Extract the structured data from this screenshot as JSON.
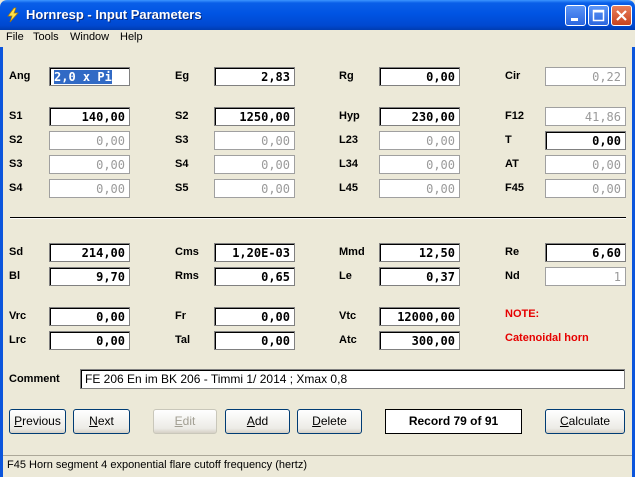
{
  "window": {
    "title": "Hornresp - Input Parameters"
  },
  "menu": [
    "File",
    "Tools",
    "Window",
    "Help"
  ],
  "params": [
    {
      "id": "ang",
      "label": "Ang",
      "value": "2,0 x Pi",
      "state": "selected"
    },
    {
      "id": "eg",
      "label": "Eg",
      "value": "2,83",
      "state": "on"
    },
    {
      "id": "rg",
      "label": "Rg",
      "value": "0,00",
      "state": "on"
    },
    {
      "id": "cir",
      "label": "Cir",
      "value": "0,22",
      "state": "off"
    },
    {
      "id": "s1",
      "label": "S1",
      "value": "140,00",
      "state": "on"
    },
    {
      "id": "s2b",
      "label": "S2",
      "value": "1250,00",
      "state": "on"
    },
    {
      "id": "hyp",
      "label": "Hyp",
      "value": "230,00",
      "state": "on"
    },
    {
      "id": "f12",
      "label": "F12",
      "value": "41,86",
      "state": "off"
    },
    {
      "id": "s2",
      "label": "S2",
      "value": "0,00",
      "state": "off"
    },
    {
      "id": "s3b",
      "label": "S3",
      "value": "0,00",
      "state": "off"
    },
    {
      "id": "l23",
      "label": "L23",
      "value": "0,00",
      "state": "off"
    },
    {
      "id": "t",
      "label": "T",
      "value": "0,00",
      "state": "on"
    },
    {
      "id": "s3",
      "label": "S3",
      "value": "0,00",
      "state": "off"
    },
    {
      "id": "s4b",
      "label": "S4",
      "value": "0,00",
      "state": "off"
    },
    {
      "id": "l34",
      "label": "L34",
      "value": "0,00",
      "state": "off"
    },
    {
      "id": "at",
      "label": "AT",
      "value": "0,00",
      "state": "off"
    },
    {
      "id": "s4",
      "label": "S4",
      "value": "0,00",
      "state": "off"
    },
    {
      "id": "s5",
      "label": "S5",
      "value": "0,00",
      "state": "off"
    },
    {
      "id": "l45",
      "label": "L45",
      "value": "0,00",
      "state": "off"
    },
    {
      "id": "f45",
      "label": "F45",
      "value": "0,00",
      "state": "off"
    },
    {
      "id": "sd",
      "label": "Sd",
      "value": "214,00",
      "state": "on"
    },
    {
      "id": "cms",
      "label": "Cms",
      "value": "1,20E-03",
      "state": "on"
    },
    {
      "id": "mmd",
      "label": "Mmd",
      "value": "12,50",
      "state": "on"
    },
    {
      "id": "re",
      "label": "Re",
      "value": "6,60",
      "state": "on"
    },
    {
      "id": "bl",
      "label": "Bl",
      "value": "9,70",
      "state": "on"
    },
    {
      "id": "rms",
      "label": "Rms",
      "value": "0,65",
      "state": "on"
    },
    {
      "id": "le",
      "label": "Le",
      "value": "0,37",
      "state": "on"
    },
    {
      "id": "nd",
      "label": "Nd",
      "value": "1",
      "state": "off"
    },
    {
      "id": "vrc",
      "label": "Vrc",
      "value": "0,00",
      "state": "on"
    },
    {
      "id": "fr",
      "label": "Fr",
      "value": "0,00",
      "state": "on"
    },
    {
      "id": "vtc",
      "label": "Vtc",
      "value": "12000,00",
      "state": "on"
    },
    {
      "id": "lrc",
      "label": "Lrc",
      "value": "0,00",
      "state": "on"
    },
    {
      "id": "tal",
      "label": "Tal",
      "value": "0,00",
      "state": "on"
    },
    {
      "id": "atc",
      "label": "Atc",
      "value": "300,00",
      "state": "on"
    }
  ],
  "note": {
    "label": "NOTE:",
    "text": "Catenoidal horn",
    "color": "#e60000"
  },
  "comment": {
    "label": "Comment",
    "value": "FE 206 En im BK 206 - Timmi 1/ 2014 ; Xmax 0,8"
  },
  "buttons": {
    "previous": "Previous",
    "next": "Next",
    "edit": "Edit",
    "add": "Add",
    "delete": "Delete",
    "calculate": "Calculate"
  },
  "record": "Record 79 of 91",
  "status": "F45   Horn segment 4 exponential flare cutoff frequency  (hertz)"
}
